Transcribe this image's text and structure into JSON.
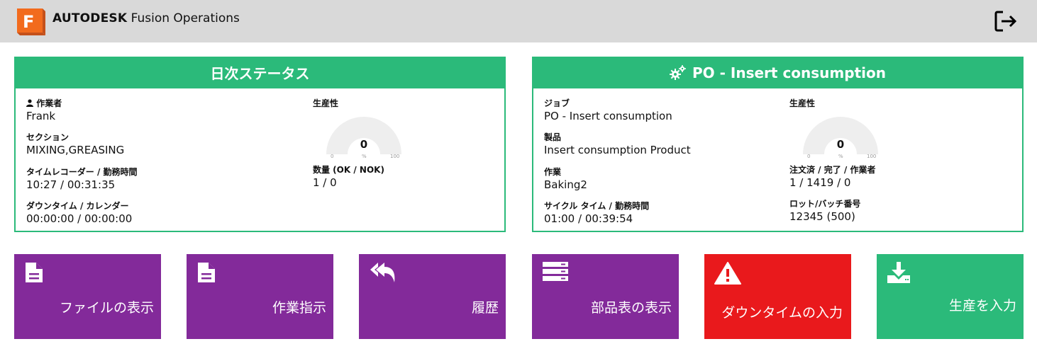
{
  "header": {
    "brand_bold": "AUTODESK",
    "brand_rest": "Fusion Operations",
    "logo_letter": "F",
    "logout_icon": "logout-icon"
  },
  "daily_status": {
    "title": "日次ステータス",
    "operator_label": "作業者",
    "operator": "Frank",
    "section_label": "セクション",
    "section": "MIXING,GREASING",
    "time_label": "タイムレコーダー / 勤務時間",
    "time": "10:27 / 00:31:35",
    "downtime_label": "ダウンタイム / カレンダー",
    "downtime": "00:00:00 / 00:00:00",
    "productivity_label": "生産性",
    "gauge_value": "0",
    "gauge_min": "0",
    "gauge_unit": "%",
    "gauge_max": "100",
    "quantity_label": "数量 (OK / NOK)",
    "quantity": "1 / 0"
  },
  "po": {
    "title": "PO - Insert consumption",
    "job_label": "ジョブ",
    "job": "PO - Insert consumption",
    "product_label": "製品",
    "product": "Insert consumption Product",
    "operation_label": "作業",
    "operation": "Baking2",
    "cycle_label": "サイクル タイム / 勤務時間",
    "cycle": "01:00 / 00:39:54",
    "productivity_label": "生産性",
    "gauge_value": "0",
    "gauge_min": "0",
    "gauge_unit": "%",
    "gauge_max": "100",
    "ordered_label": "注文済 / 完了 / 作業者",
    "ordered": "1 / 1419 / 0",
    "lot_label": "ロット/バッチ番号",
    "lot": "12345 (500)"
  },
  "tiles": [
    {
      "label": "ファイルの表示",
      "icon": "file-icon",
      "color": "#832a9a"
    },
    {
      "label": "作業指示",
      "icon": "file-icon",
      "color": "#832a9a"
    },
    {
      "label": "履歴",
      "icon": "reply-all-icon",
      "color": "#832a9a"
    },
    {
      "label": "部品表の表示",
      "icon": "server-icon",
      "color": "#832a9a"
    },
    {
      "label": "ダウンタイムの入力",
      "icon": "warning-icon",
      "color": "#e9191c"
    },
    {
      "label": "生産を入力",
      "icon": "download-icon",
      "color": "#2bba7a"
    }
  ],
  "colors": {
    "header_bg": "#d9d9d9",
    "accent_green": "#2bba7a",
    "tile_purple": "#832a9a",
    "tile_red": "#e9191c"
  }
}
